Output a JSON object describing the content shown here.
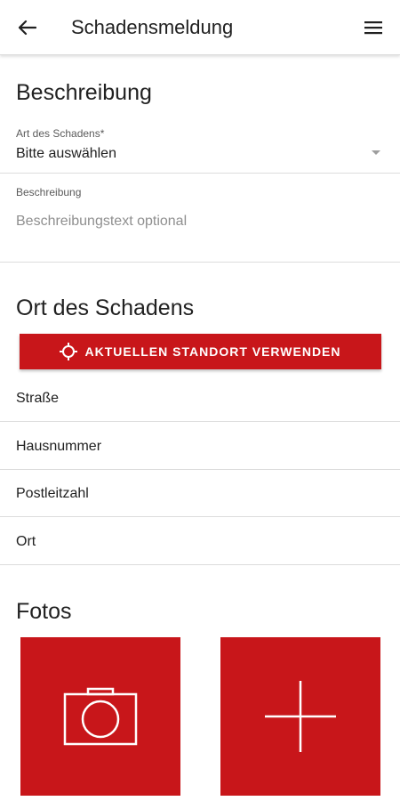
{
  "appbar": {
    "back_icon": "arrow-left-icon",
    "title": "Schadensmeldung",
    "menu_icon": "hamburger-menu-icon"
  },
  "beschreibung": {
    "heading": "Beschreibung",
    "art_label": "Art des Schadens*",
    "art_value": "Bitte auswählen",
    "dropdown_icon": "dropdown-arrow-icon",
    "beschreibung_label": "Beschreibung",
    "beschreibung_placeholder": "Beschreibungstext optional"
  },
  "ort": {
    "heading": "Ort des Schadens",
    "location_button": "AKTUELLEN STANDORT VERWENDEN",
    "location_icon": "crosshair-location-icon",
    "strasse": "Straße",
    "hausnummer": "Hausnummer",
    "postleitzahl": "Postleitzahl",
    "ort": "Ort"
  },
  "fotos": {
    "heading": "Fotos",
    "camera_icon": "camera-icon",
    "add_icon": "plus-icon"
  },
  "colors": {
    "accent": "#c8161a",
    "divider": "#dcdcdc",
    "text": "#212121",
    "placeholder": "#8f8f8f"
  }
}
